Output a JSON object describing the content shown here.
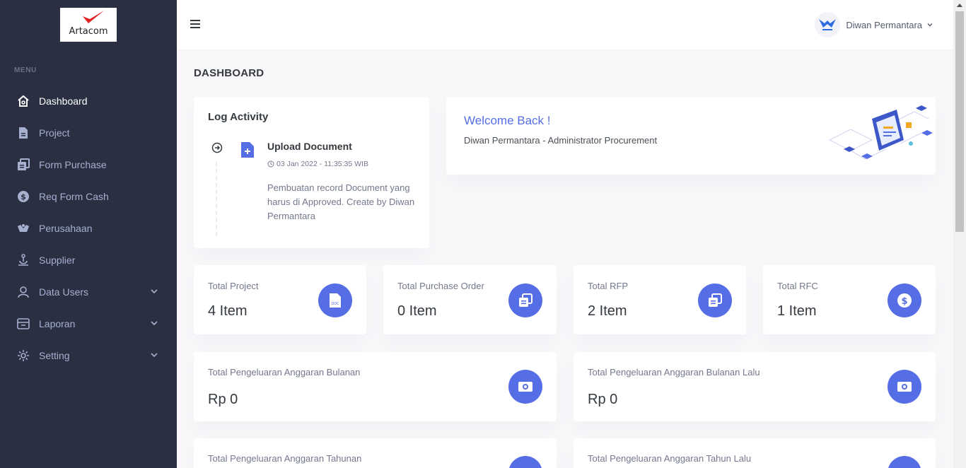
{
  "brand": {
    "logo_text": "Artacom"
  },
  "sidebar": {
    "menu_title": "MENU",
    "items": [
      {
        "label": "Dashboard",
        "icon": "home-icon",
        "active": true,
        "has_submenu": false
      },
      {
        "label": "Project",
        "icon": "file-icon",
        "active": false,
        "has_submenu": false
      },
      {
        "label": "Form Purchase",
        "icon": "copy-icon",
        "active": false,
        "has_submenu": false
      },
      {
        "label": "Req Form Cash",
        "icon": "dollar-circle-icon",
        "active": false,
        "has_submenu": false
      },
      {
        "label": "Perusahaan",
        "icon": "building-icon",
        "active": false,
        "has_submenu": false
      },
      {
        "label": "Supplier",
        "icon": "dolly-icon",
        "active": false,
        "has_submenu": false
      },
      {
        "label": "Data Users",
        "icon": "user-icon",
        "active": false,
        "has_submenu": true
      },
      {
        "label": "Laporan",
        "icon": "report-icon",
        "active": false,
        "has_submenu": true
      },
      {
        "label": "Setting",
        "icon": "gear-icon",
        "active": false,
        "has_submenu": true
      }
    ]
  },
  "topbar": {
    "user_name": "Diwan Permantara"
  },
  "page": {
    "title": "DASHBOARD"
  },
  "log_activity": {
    "title": "Log Activity",
    "item": {
      "heading": "Upload Document",
      "time": "03 Jan 2022 - 11:35:35 WIB",
      "description": "Pembuatan record Document yang harus di Approved. Create by Diwan Permantara"
    }
  },
  "welcome": {
    "title": "Welcome Back !",
    "subtitle": "Diwan Permantara - Administrator Procurement"
  },
  "stats": [
    {
      "label": "Total Project",
      "value": "4 Item",
      "icon": "document-icon"
    },
    {
      "label": "Total Purchase Order",
      "value": "0 Item",
      "icon": "copy-icon"
    },
    {
      "label": "Total RFP",
      "value": "2 Item",
      "icon": "copy-icon"
    },
    {
      "label": "Total RFC",
      "value": "1 Item",
      "icon": "dollar-icon"
    }
  ],
  "budget": [
    {
      "label": "Total Pengeluaran Anggaran Bulanan",
      "value": "Rp 0",
      "icon": "money-icon"
    },
    {
      "label": "Total Pengeluaran Anggaran Bulanan Lalu",
      "value": "Rp 0",
      "icon": "money-icon"
    },
    {
      "label": "Total Pengeluaran Anggaran Tahunan",
      "icon": "money-icon"
    },
    {
      "label": "Total Pengeluaran Anggaran Tahun Lalu",
      "icon": "money-icon"
    }
  ],
  "colors": {
    "sidebar_bg": "#2a3042",
    "accent": "#556ee6",
    "page_bg": "#f8f8fb",
    "logo_red": "#e02020"
  }
}
